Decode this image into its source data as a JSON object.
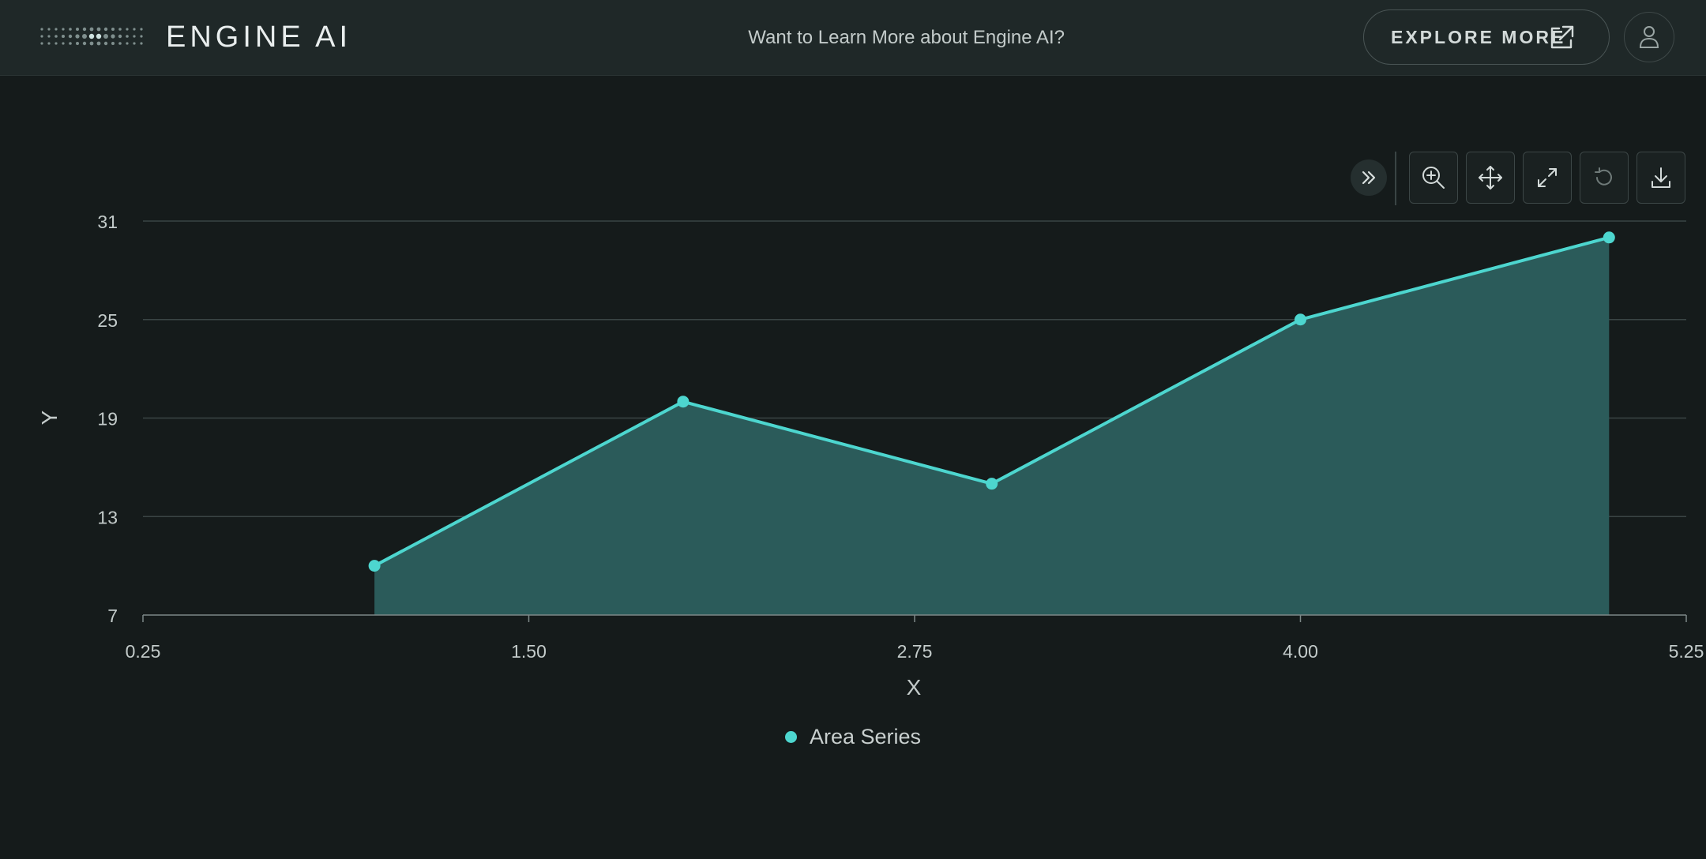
{
  "header": {
    "brand": "ENGINE AI",
    "learn_more": "Want to Learn More about Engine AI?",
    "explore_label": "EXPLORE MORE"
  },
  "icons": {
    "logo": "dot-grid-logo-icon",
    "explore": "external-link-icon",
    "avatar": "user-icon",
    "toolbar": [
      "double-chevron-right-icon",
      "zoom-in-icon",
      "pan-icon",
      "fullscreen-icon",
      "reset-icon",
      "download-icon"
    ]
  },
  "colors": {
    "background": "#151b1b",
    "header": "#1f2828",
    "series_line": "#4dd6cf",
    "series_fill": "#2b5b5a",
    "grid": "#3a4545"
  },
  "chart_data": {
    "type": "area",
    "xlabel": "X",
    "ylabel": "Y",
    "xlim": [
      0.25,
      5.25
    ],
    "ylim": [
      7,
      31
    ],
    "x_ticks": [
      "0.25",
      "1.50",
      "2.75",
      "4.00",
      "5.25"
    ],
    "y_ticks": [
      "7",
      "13",
      "19",
      "25",
      "31"
    ],
    "grid": true,
    "legend_position": "bottom-center",
    "series": [
      {
        "name": "Area Series",
        "x": [
          1.0,
          2.0,
          3.0,
          4.0,
          5.0
        ],
        "y": [
          10,
          20,
          15,
          25,
          30
        ]
      }
    ]
  }
}
